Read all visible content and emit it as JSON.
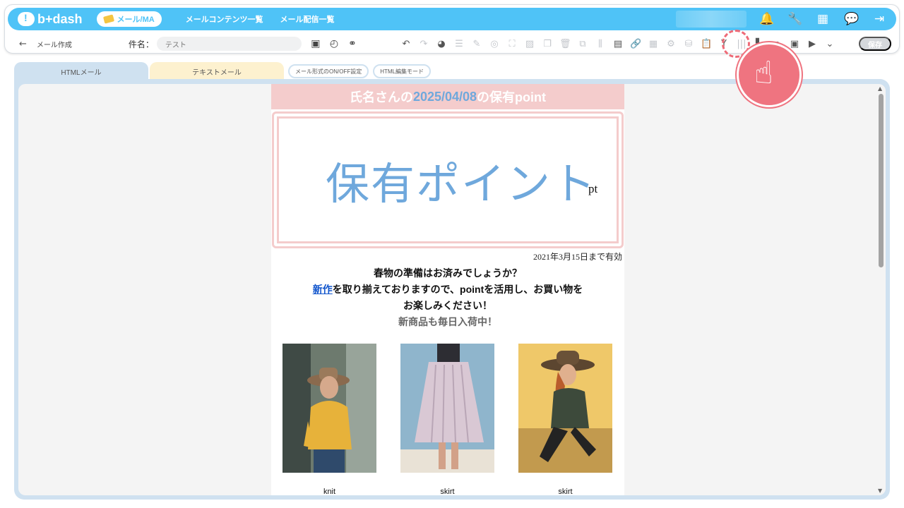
{
  "app": {
    "logo_text": "b+dash",
    "module_pill": "メール/MA"
  },
  "nav": {
    "links": [
      "メールコンテンツ一覧",
      "メール配信一覧"
    ]
  },
  "page": {
    "back_label": "←",
    "title": "メール作成"
  },
  "subject": {
    "label": "件名：",
    "value": "テスト"
  },
  "toolbar": {
    "save_label": "保存"
  },
  "tabs": {
    "html_mail": "HTMLメール",
    "text_mail": "テキストメール",
    "format_toggle": "メール形式のON/OFF設定",
    "html_edit_mode": "HTML編集モード"
  },
  "email": {
    "header_pre": "氏名さんの",
    "header_date": "2025/04/08",
    "header_post": "の保有point",
    "points_title": "保有ポイント",
    "points_unit": "pt",
    "valid_until": "2021年3月15日まで有効",
    "line1": "春物の準備はお済みでしょうか？",
    "line2_link": "新作",
    "line2_rest": "を取り揃えておりますので、pointを活用し、お買い物を",
    "line3": "お楽しみください！",
    "line4": "新商品も毎日入荷中！",
    "products": [
      {
        "label": "knit"
      },
      {
        "label": "skirt"
      },
      {
        "label": "skirt"
      }
    ]
  },
  "colors": {
    "brand": "#4fc3f7",
    "header_pink": "#f4cccc",
    "points_blue": "#6fa8dc",
    "highlight": "#ef7480"
  }
}
